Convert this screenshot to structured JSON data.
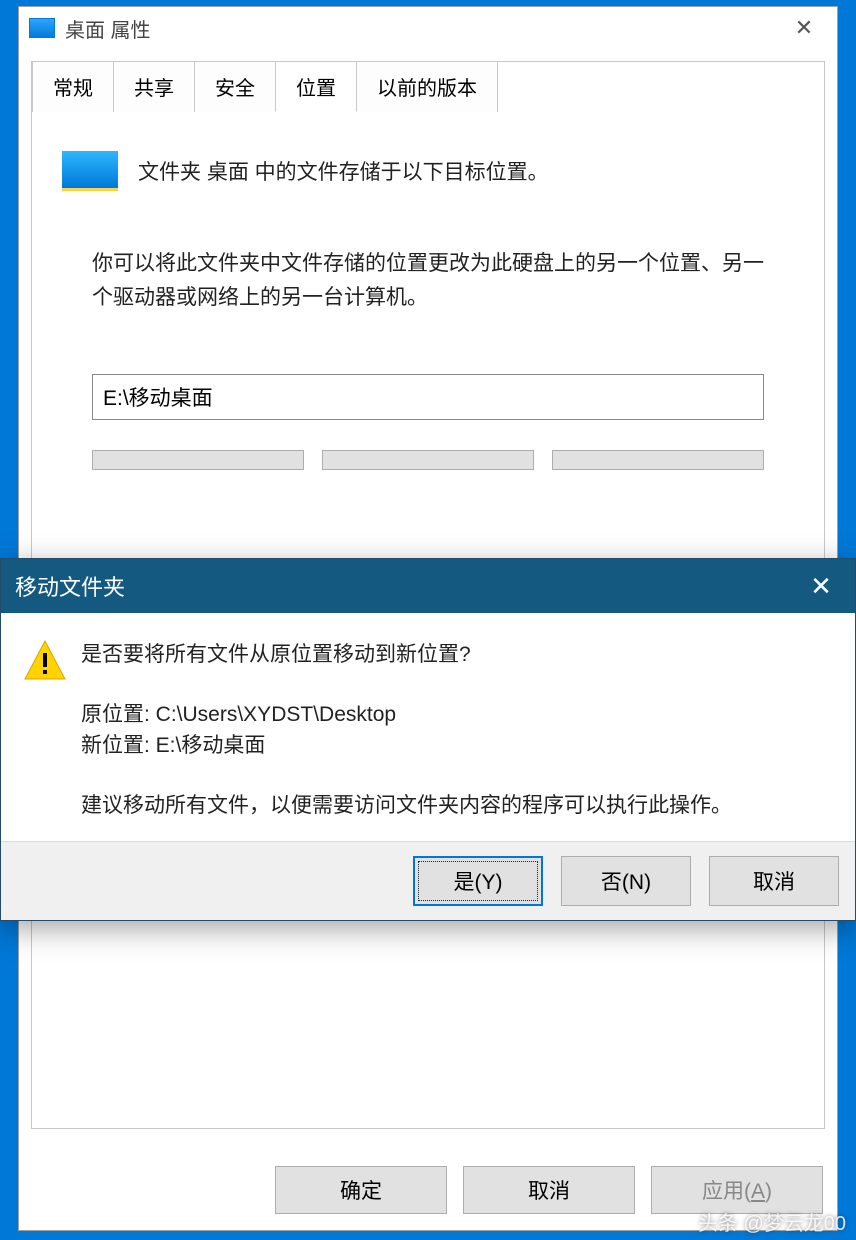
{
  "props": {
    "title": "桌面 属性",
    "tabs": {
      "general": "常规",
      "sharing": "共享",
      "security": "安全",
      "location": "位置",
      "previous": "以前的版本"
    },
    "desc1": "文件夹 桌面 中的文件存储于以下目标位置。",
    "desc2": "你可以将此文件夹中文件存储的位置更改为此硬盘上的另一个位置、另一个驱动器或网络上的另一台计算机。",
    "path": "E:\\移动桌面",
    "buttons": {
      "ok": "确定",
      "cancel": "取消",
      "apply_pre": "应用(",
      "apply_u": "A",
      "apply_post": ")"
    }
  },
  "modal": {
    "title": "移动文件夹",
    "question": "是否要将所有文件从原位置移动到新位置?",
    "old_label": "原位置: ",
    "old_path": "C:\\Users\\XYDST\\Desktop",
    "new_label": "新位置: ",
    "new_path": "E:\\移动桌面",
    "advice": "建议移动所有文件，以便需要访问文件夹内容的程序可以执行此操作。",
    "yes": "是(Y)",
    "no": "否(N)",
    "cancel": "取消"
  },
  "watermark": "头条 @梦云龙00"
}
